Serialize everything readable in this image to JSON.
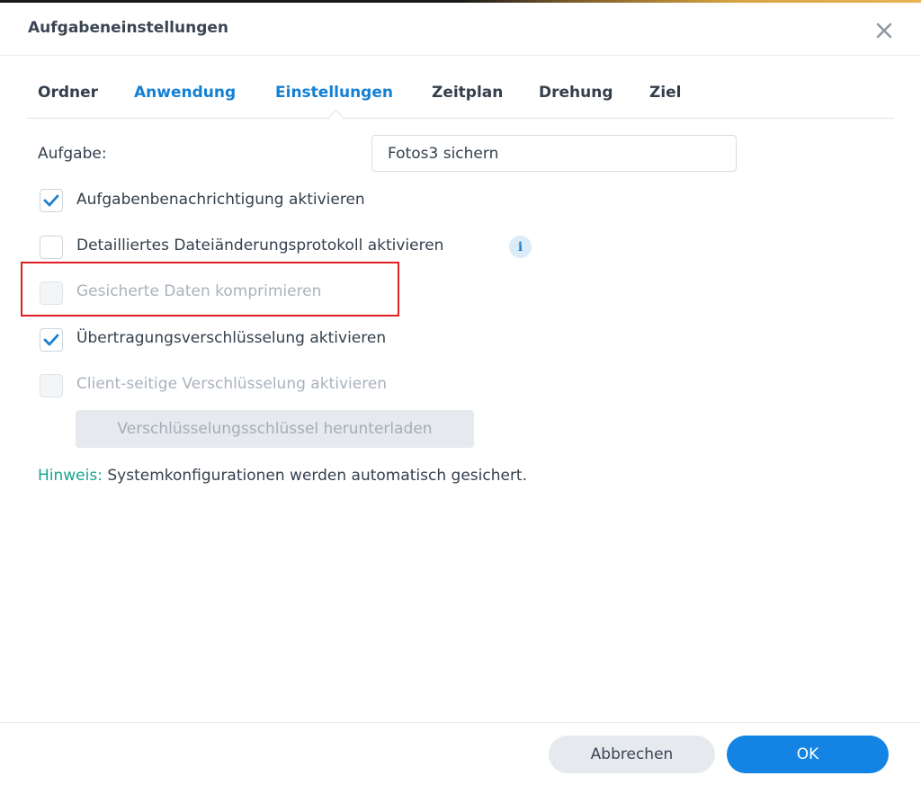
{
  "dialog": {
    "title": "Aufgabeneinstellungen",
    "close_icon": "close-icon"
  },
  "tabs": [
    {
      "label": "Ordner",
      "state": "default"
    },
    {
      "label": "Anwendung",
      "state": "link"
    },
    {
      "label": "Einstellungen",
      "state": "active"
    },
    {
      "label": "Zeitplan",
      "state": "default"
    },
    {
      "label": "Drehung",
      "state": "default"
    },
    {
      "label": "Ziel",
      "state": "default"
    }
  ],
  "task": {
    "label": "Aufgabe:",
    "value": "Fotos3 sichern"
  },
  "options": [
    {
      "label": "Aufgabenbenachrichtigung aktivieren",
      "checked": true,
      "enabled": true
    },
    {
      "label": "Detailliertes Dateiänderungsprotokoll aktivieren",
      "checked": false,
      "enabled": true,
      "info_icon": "info-icon"
    },
    {
      "label": "Gesicherte Daten komprimieren",
      "checked": false,
      "enabled": false
    },
    {
      "label": "Übertragungsverschlüsselung aktivieren",
      "checked": true,
      "enabled": true
    },
    {
      "label": "Client-seitige Verschlüsselung aktivieren",
      "checked": false,
      "enabled": false
    }
  ],
  "download_key_button": "Verschlüsselungsschlüssel herunterladen",
  "hint": {
    "label": "Hinweis:",
    "text": "Systemkonfigurationen werden automatisch gesichert."
  },
  "footer": {
    "cancel_label": "Abbrechen",
    "ok_label": "OK"
  },
  "colors": {
    "accent": "#1384e3",
    "tab_active": "#1480d4",
    "hint": "#16a38f",
    "highlight_box": "#e01e24",
    "check": "#1b7fd0"
  }
}
